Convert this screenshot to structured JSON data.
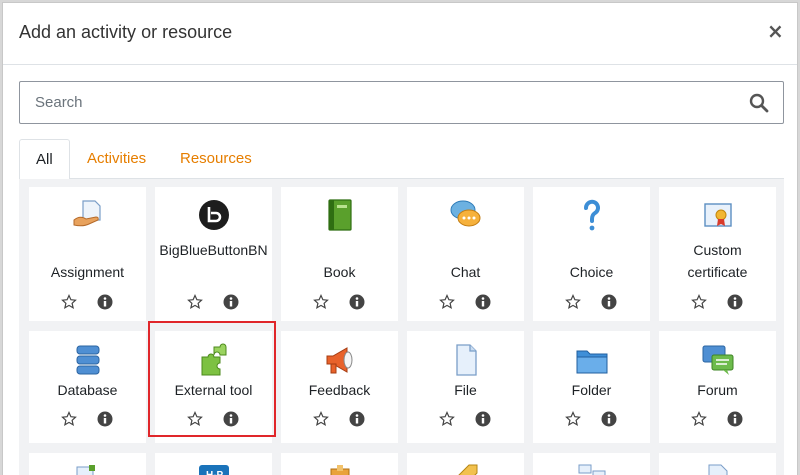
{
  "modal": {
    "title": "Add an activity or resource",
    "close_symbol": "×"
  },
  "search": {
    "placeholder": "Search"
  },
  "tabs": [
    {
      "label": "All",
      "active": true
    },
    {
      "label": "Activities",
      "active": false
    },
    {
      "label": "Resources",
      "active": false
    }
  ],
  "colors": {
    "tab_link": "#e67e00",
    "highlight_border": "#e0262a",
    "grid_background": "#f1f2f4"
  },
  "activities": [
    {
      "label": "Assignment",
      "icon": "assignment-icon"
    },
    {
      "label": "BigBlueButtonBN",
      "icon": "bigbluebutton-icon"
    },
    {
      "label": "Book",
      "icon": "book-icon"
    },
    {
      "label": "Chat",
      "icon": "chat-icon"
    },
    {
      "label": "Choice",
      "icon": "choice-icon"
    },
    {
      "label": "Custom certificate",
      "icon": "certificate-icon"
    },
    {
      "label": "Database",
      "icon": "database-icon"
    },
    {
      "label": "External tool",
      "icon": "external-tool-icon",
      "highlighted": true
    },
    {
      "label": "Feedback",
      "icon": "feedback-icon"
    },
    {
      "label": "File",
      "icon": "file-icon"
    },
    {
      "label": "Folder",
      "icon": "folder-icon"
    },
    {
      "label": "Forum",
      "icon": "forum-icon"
    }
  ]
}
